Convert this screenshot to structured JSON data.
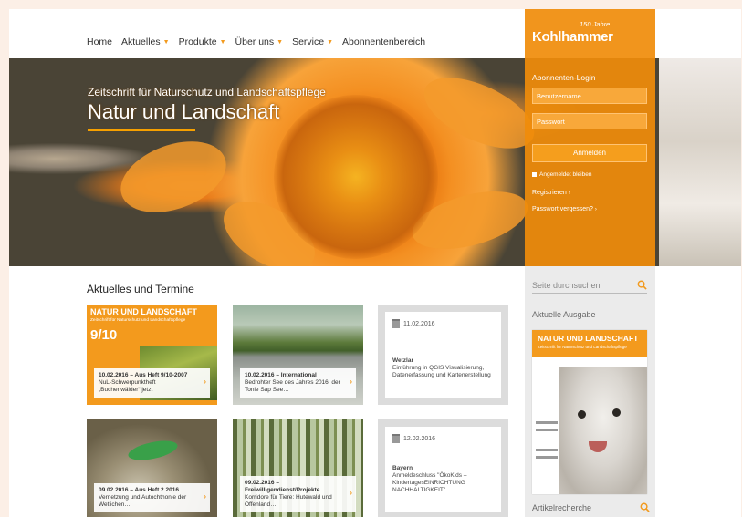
{
  "nav": {
    "items": [
      {
        "label": "Home",
        "caret": false
      },
      {
        "label": "Aktuelles",
        "caret": true
      },
      {
        "label": "Produkte",
        "caret": true
      },
      {
        "label": "Über uns",
        "caret": true
      },
      {
        "label": "Service",
        "caret": true
      },
      {
        "label": "Abonnentenbereich",
        "caret": false
      }
    ]
  },
  "brand": {
    "logo": "Kohlhammer",
    "anniversary": "150 Jahre",
    "accent": "#f39a1d"
  },
  "hero": {
    "subtitle": "Zeitschrift für Naturschutz und Landschaftspflege",
    "title": "Natur und Landschaft"
  },
  "login": {
    "title": "Abonnenten-Login",
    "username_placeholder": "Benutzername",
    "password_placeholder": "Passwort",
    "submit": "Anmelden",
    "remember": "Angemeldet bleiben",
    "register": "Registrieren",
    "forgot": "Passwort vergessen?"
  },
  "sidebar": {
    "search_placeholder": "Seite durchsuchen",
    "current_issue_heading": "Aktuelle Ausgabe",
    "issue_title": "NATUR UND LANDSCHAFT",
    "issue_subtitle": "Zeitschrift für Naturschutz und Landschaftspflege",
    "article_search": "Artikelrecherche"
  },
  "main": {
    "section_title": "Aktuelles und Termine",
    "cards": [
      {
        "cover_title": "NATUR UND LANDSCHAFT",
        "cover_sub": "Zeitschrift für Naturschutz und Landschaftspflege",
        "cover_issue": "9/10",
        "head": "10.02.2016 – Aus Heft 9/10-2007",
        "body": "NuL-Schwerpunktheft „Buchenwälder“ jetzt"
      },
      {
        "head": "10.02.2016 – International",
        "body": "Bedrohter See des Jahres 2016: der Tonle Sap See…"
      },
      {
        "date": "11.02.2016",
        "head": "Wetzlar",
        "body": "Einführung in QGIS Visualisierung, Datenerfassung und Kartenerstellung"
      },
      {
        "head": "09.02.2016 – Aus Heft 2 2016",
        "body": "Vernetzung und Autochthonie der Wetlichen…"
      },
      {
        "head": "09.02.2016 – Freiwilligendienst/Projekte",
        "body": "Korridore für Tiere: Hutewald und Offenland…"
      },
      {
        "date": "12.02.2016",
        "head": "Bayern",
        "body": "Anmeldeschluss \"ÖkoKids – KindertagesEINRICHTUNG NACHHALTIGKEIT\""
      }
    ]
  }
}
